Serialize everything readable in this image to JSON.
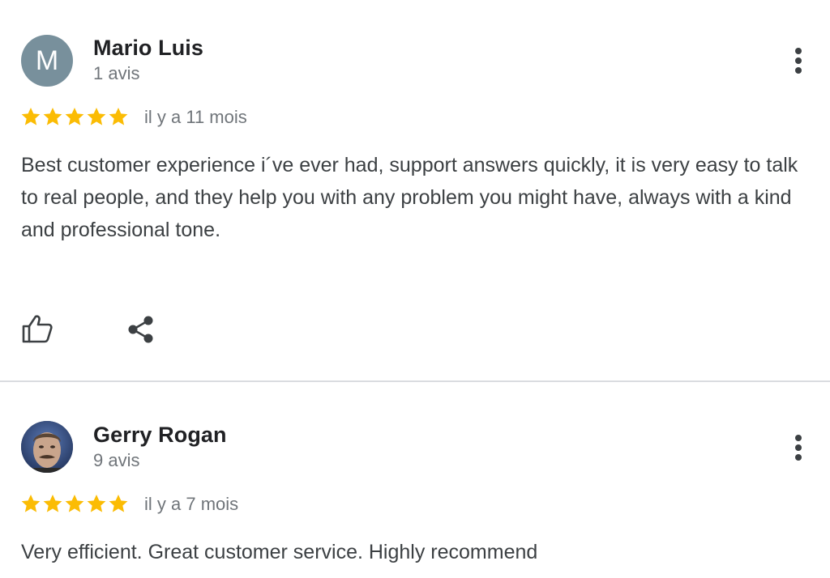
{
  "colors": {
    "star": "#fbbc04",
    "avatar_letter_bg": "#78909c",
    "divider": "#dadce0",
    "secondary_text": "#70757a"
  },
  "reviews": [
    {
      "author": "Mario Luis",
      "avatar_letter": "M",
      "review_count": "1 avis",
      "rating": 5,
      "time": "il y a 11 mois",
      "text": "Best customer experience i´ve ever had, support answers quickly, it is very easy to talk to real people, and they help you with any problem you might have, always with a kind and professional tone.",
      "actions": [
        "thumbs-up-icon",
        "share-icon"
      ]
    },
    {
      "author": "Gerry Rogan",
      "avatar": "profile-photo",
      "review_count": "9 avis",
      "rating": 5,
      "time": "il y a 7 mois",
      "text": "Very efficient. Great customer service. Highly recommend"
    }
  ]
}
